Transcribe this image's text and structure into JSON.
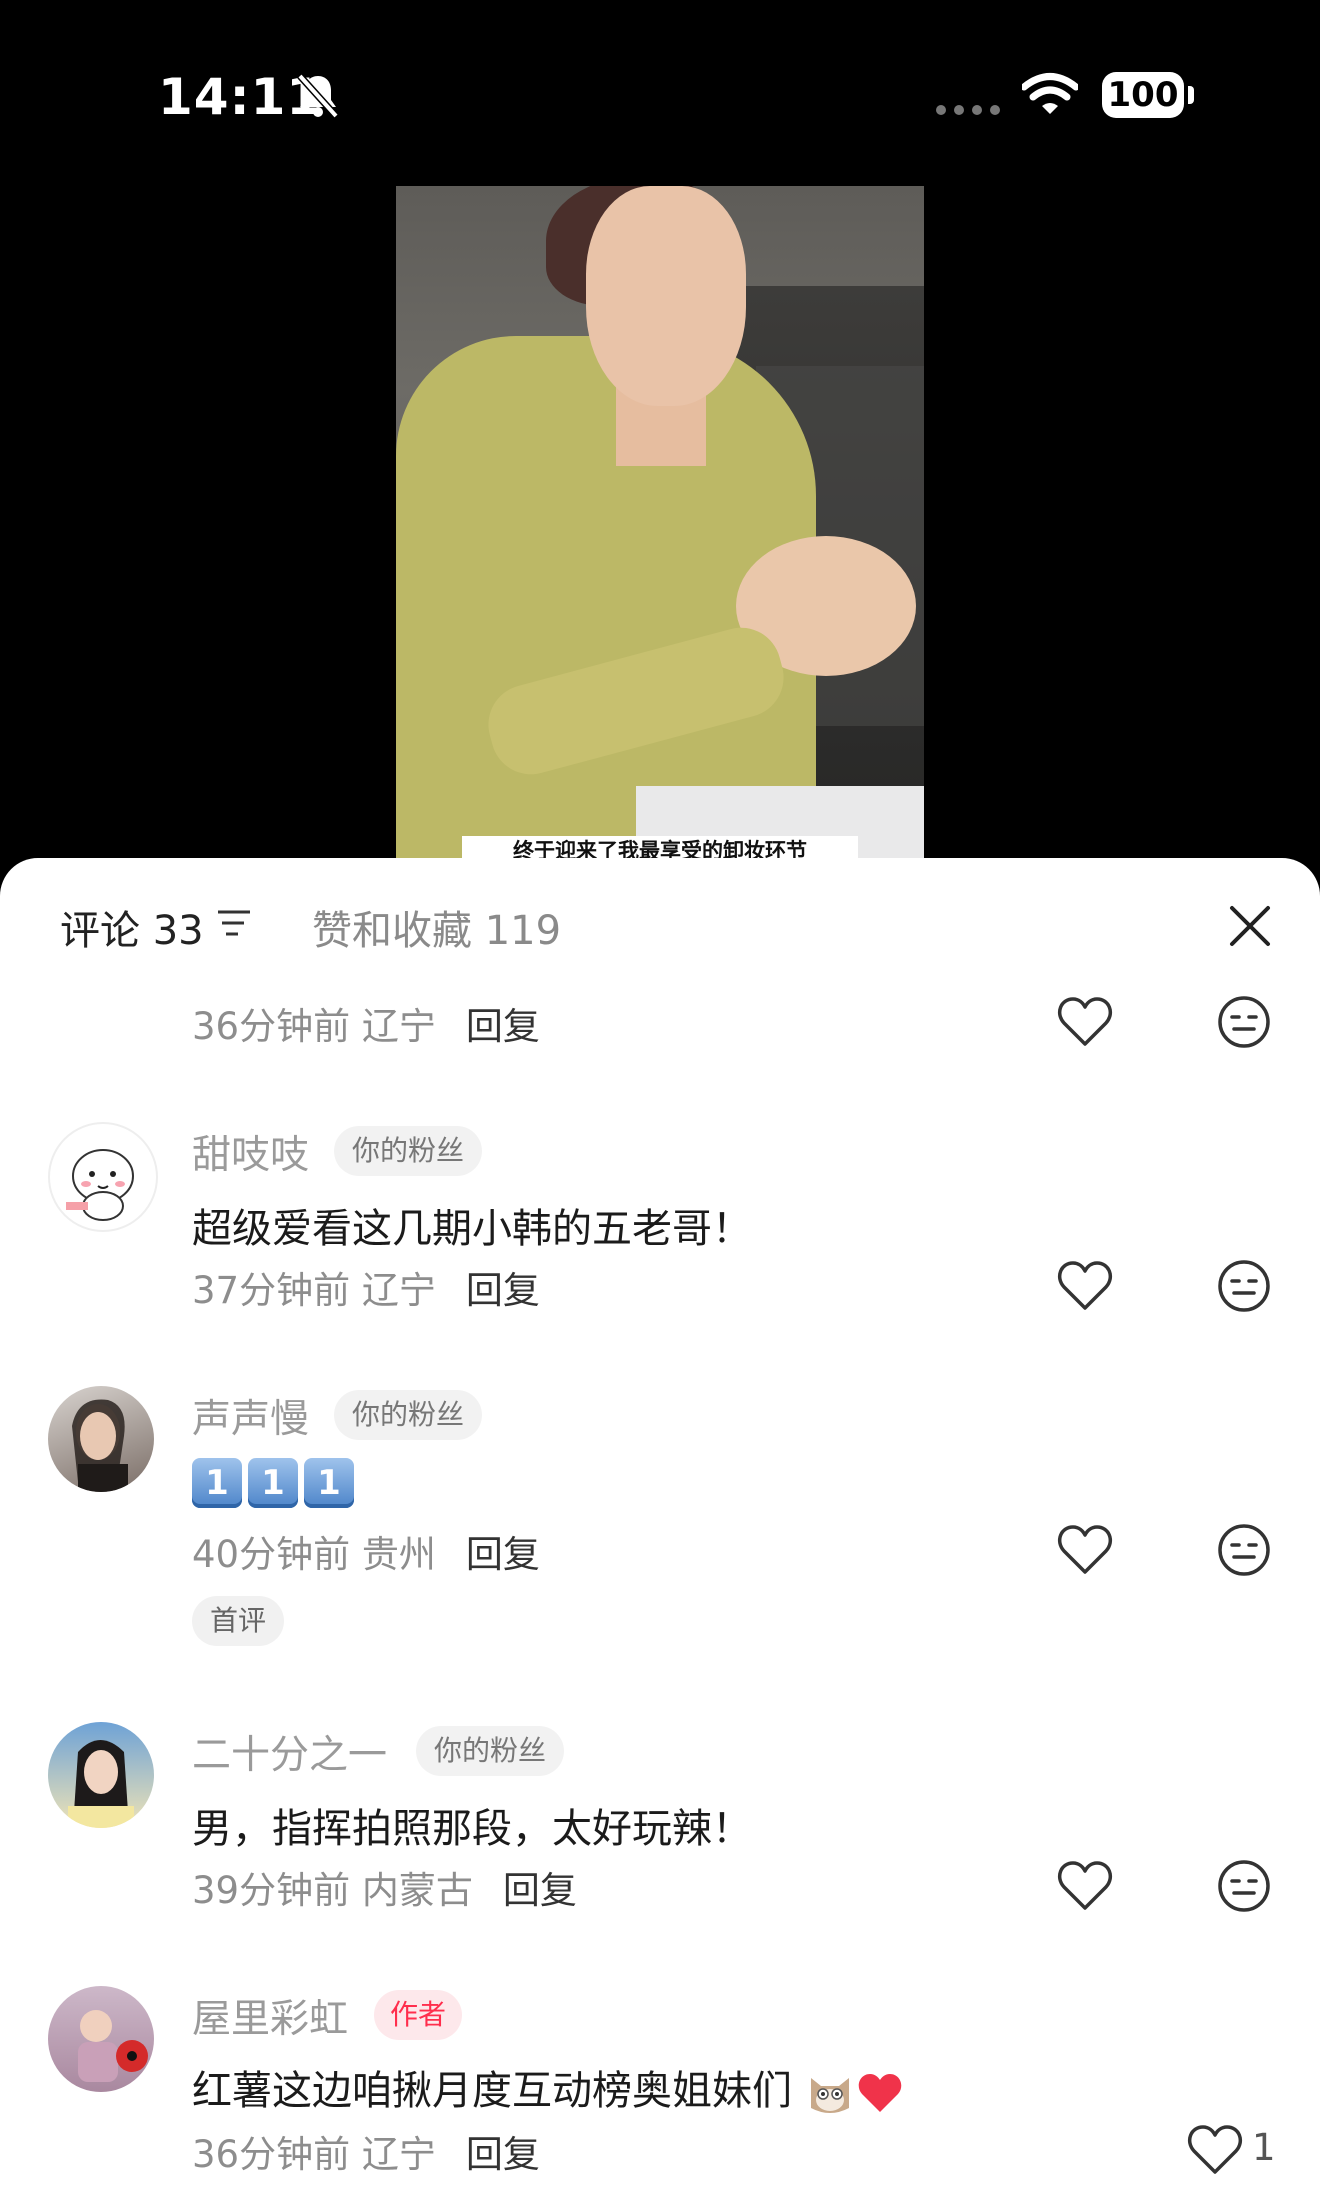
{
  "status_bar": {
    "time": "14:11",
    "battery": "100"
  },
  "video": {
    "caption": "终于迎来了我最享受的卸妆环节"
  },
  "tabs": {
    "comments_label": "评论 33",
    "likes_label": "赞和收藏 119"
  },
  "comments": [
    {
      "time_location": "36分钟前 辽宁",
      "reply": "回复"
    },
    {
      "username": "甜吱吱",
      "badge": "你的粉丝",
      "text": "超级爱看这几期小韩的五老哥！",
      "time_location": "37分钟前 辽宁",
      "reply": "回复"
    },
    {
      "username": "声声慢",
      "badge": "你的粉丝",
      "emoji_keys": [
        "1",
        "1",
        "1"
      ],
      "time_location": "40分钟前 贵州",
      "reply": "回复",
      "tag": "首评"
    },
    {
      "username": "二十分之一",
      "badge": "你的粉丝",
      "text": "男，指挥拍照那段，太好玩辣！",
      "time_location": "39分钟前 内蒙古",
      "reply": "回复"
    },
    {
      "username": "屋里彩虹",
      "badge": "作者",
      "text": "红薯这边咱揪月度互动榜奥姐妹们",
      "time_location": "36分钟前 辽宁",
      "reply": "回复",
      "likes": "1"
    }
  ],
  "colors": {
    "accent": "#ff2e4d",
    "author_badge_bg": "#fde8eb"
  }
}
